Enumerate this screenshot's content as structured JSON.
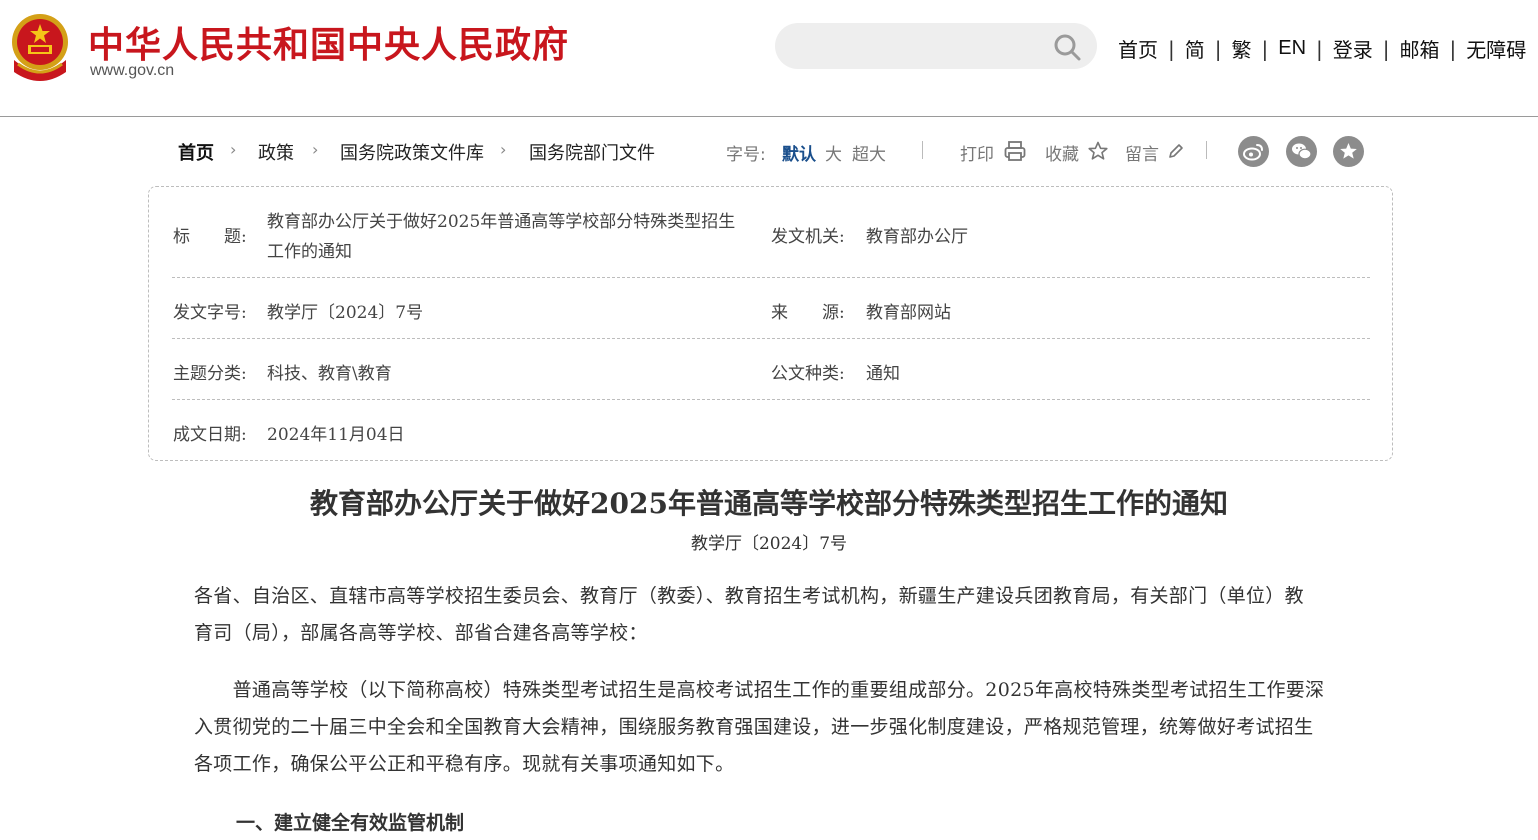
{
  "header": {
    "site_title": "中华人民共和国中央人民政府",
    "site_url": "www.gov.cn",
    "search": {
      "placeholder": ""
    },
    "nav": [
      "首页",
      "简",
      "繁",
      "EN",
      "登录",
      "邮箱",
      "无障碍"
    ]
  },
  "breadcrumb": [
    "首页",
    "政策",
    "国务院政策文件库",
    "国务院部门文件"
  ],
  "toolbar": {
    "font_size_label": "字号:",
    "font_default": "默认",
    "font_large": "大",
    "font_xlarge": "超大",
    "print_label": "打印",
    "favorite_label": "收藏",
    "comment_label": "留言"
  },
  "colors": {
    "brand_red": "#c8161d",
    "active_blue": "#1a4f8c",
    "icon_gray": "#8c8c8c"
  },
  "info": {
    "title_label": "标　　题:",
    "title_line1": "教育部办公厅关于做好2025年普通高等学校部分特殊类型招生",
    "title_line2": "工作的通知",
    "issuer_label": "发文机关:",
    "issuer": "教育部办公厅",
    "doc_no_label": "发文字号:",
    "doc_no": "教学厅〔2024〕7号",
    "source_label": "来　　源:",
    "source": "教育部网站",
    "topic_label": "主题分类:",
    "topic": "科技、教育\\教育",
    "doc_type_label": "公文种类:",
    "doc_type": "通知",
    "date_label": "成文日期:",
    "date": "2024年11月04日"
  },
  "article": {
    "title": "教育部办公厅关于做好2025年普通高等学校部分特殊类型招生工作的通知",
    "doc_number": "教学厅〔2024〕7号",
    "addressees_line1": "各省、自治区、直辖市高等学校招生委员会、教育厅（教委）、教育招生考试机构，新疆生产建设兵团教育局，有关部门（单位）教",
    "addressees_line2": "育司（局），部属各高等学校、部省合建各高等学校：",
    "para1_line1": "　　普通高等学校（以下简称高校）特殊类型考试招生是高校考试招生工作的重要组成部分。2025年高校特殊类型考试招生工作要深",
    "para1_line2": "入贯彻党的二十届三中全会和全国教育大会精神，围绕服务教育强国建设，进一步强化制度建设，严格规范管理，统筹做好考试招生",
    "para1_line3": "各项工作，确保公平公正和平稳有序。现就有关事项通知如下。",
    "section1": "一、建立健全有效监管机制"
  }
}
